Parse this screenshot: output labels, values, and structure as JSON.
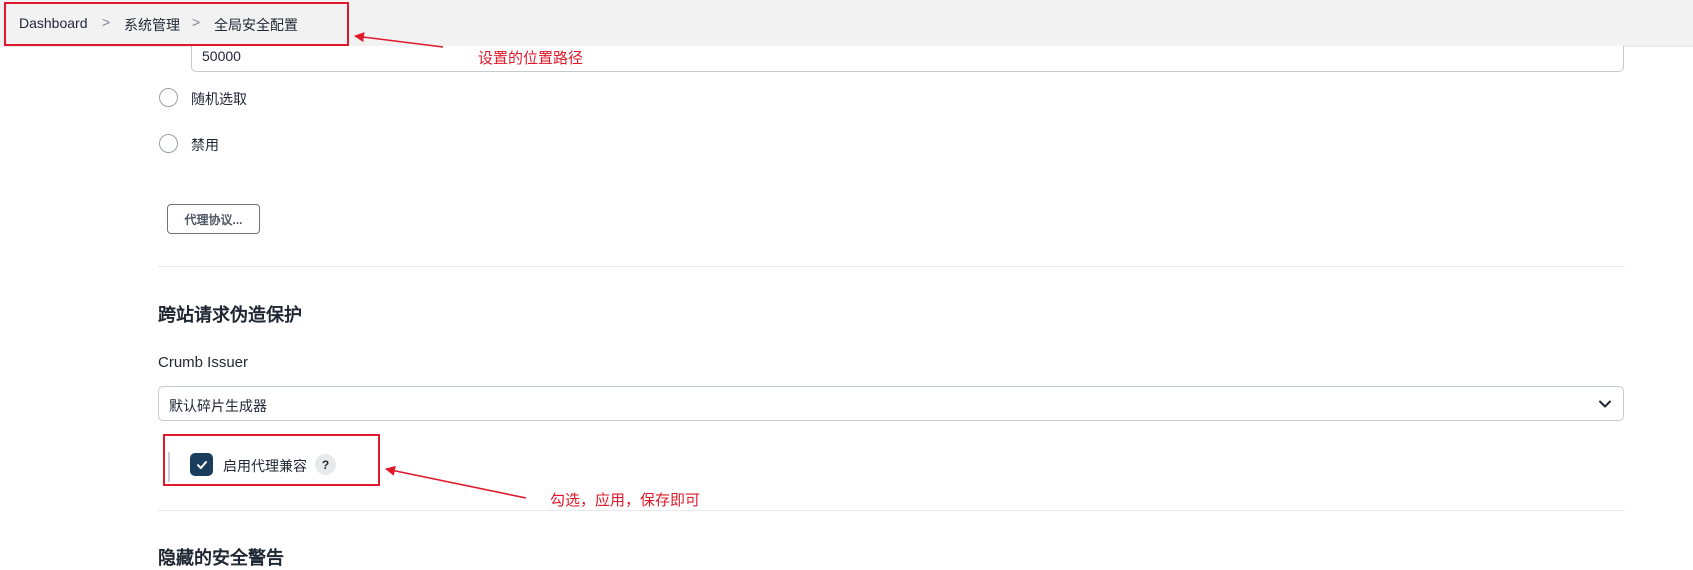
{
  "breadcrumb": {
    "items": [
      "Dashboard",
      "系统管理",
      "全局安全配置"
    ],
    "separator": ">"
  },
  "agent_port": {
    "value": "50000"
  },
  "agent_options": {
    "random_label": "随机选取",
    "disable_label": "禁用",
    "protocols_button_label": "代理协议..."
  },
  "csrf": {
    "section_title": "跨站请求伪造保护",
    "crumb_issuer_label": "Crumb Issuer",
    "crumb_issuer_selected": "默认碎片生成器",
    "proxy_compat_label": "启用代理兼容",
    "proxy_compat_checked": true,
    "help_label": "?"
  },
  "hidden_warnings": {
    "section_title": "隐藏的安全警告"
  },
  "annotations": {
    "path_note": "设置的位置路径",
    "check_note": "勾选，应用，保存即可",
    "color": "#e0192b"
  },
  "theme": {
    "checkbox_color": "#1a3d5e",
    "topbar_bg": "#f2f2f3"
  }
}
